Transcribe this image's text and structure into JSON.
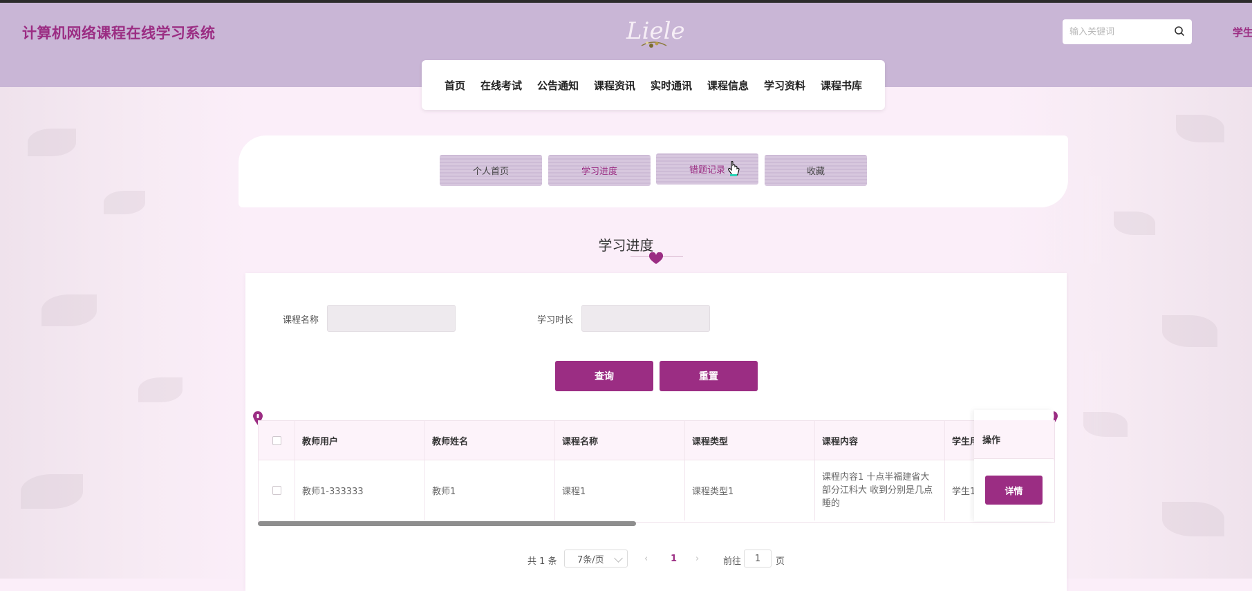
{
  "header": {
    "site_title": "计算机网络课程在线学习系统",
    "logo_text": "Liele",
    "search_placeholder": "输入关键词",
    "user_link": "学生"
  },
  "nav": {
    "items": [
      {
        "label": "首页"
      },
      {
        "label": "在线考试"
      },
      {
        "label": "公告通知"
      },
      {
        "label": "课程资讯"
      },
      {
        "label": "实时通讯"
      },
      {
        "label": "课程信息"
      },
      {
        "label": "学习资料"
      },
      {
        "label": "课程书库"
      }
    ]
  },
  "tabs": {
    "items": [
      {
        "label": "个人首页"
      },
      {
        "label": "学习进度"
      },
      {
        "label": "错题记录"
      },
      {
        "label": "收藏"
      }
    ],
    "active": "学习进度"
  },
  "page": {
    "title": "学习进度"
  },
  "filters": {
    "course_name_label": "课程名称",
    "course_name_value": "",
    "study_time_label": "学习时长",
    "study_time_value": "",
    "query_label": "查询",
    "reset_label": "重置"
  },
  "table": {
    "columns": [
      "教师用户",
      "教师姓名",
      "课程名称",
      "课程类型",
      "课程内容",
      "学生用户"
    ],
    "action_header": "操作",
    "rows": [
      {
        "teacher_user": "教师1-333333",
        "teacher_name": "教师1",
        "course_name": "课程1",
        "course_type": "课程类型1",
        "course_content": "课程内容1 十点半福建省大部分江科大 收到分别是几点睡的",
        "student_user": "学生1",
        "action_label": "详情"
      }
    ]
  },
  "pagination": {
    "total_text": "共 1 条",
    "page_size": "7条/页",
    "current_page": "1",
    "goto_prefix": "前往",
    "goto_value": "1",
    "goto_suffix": "页"
  },
  "colors": {
    "brand": "#9b2d83",
    "header_bg": "#c9b6d6",
    "page_bg": "#fbeef9"
  }
}
